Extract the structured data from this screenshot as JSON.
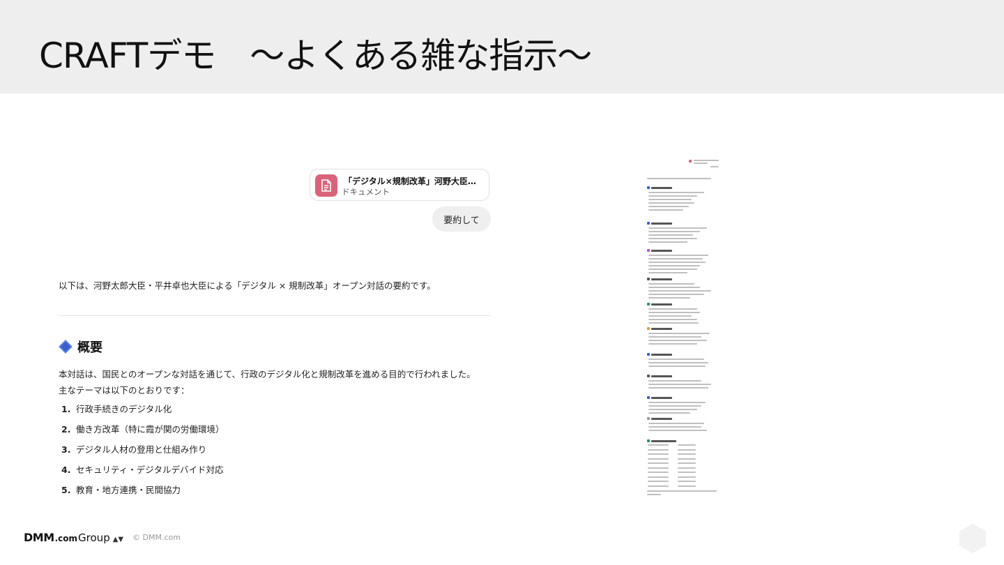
{
  "slide": {
    "title": "CRAFTデモ　～よくある雑な指示～"
  },
  "chat": {
    "attachment": {
      "title": "「デジタル×規制改革」河野大臣・平...",
      "type_label": "ドキュメント",
      "icon": "document-icon",
      "icon_color": "#d9637a"
    },
    "user_message": "要約して",
    "response": {
      "intro": "以下は、河野太郎大臣・平井卓也大臣による「デジタル × 規制改革」オープン対話の要約です。",
      "section_title": "概要",
      "section_icon": "blue-diamond-icon",
      "body_line1": "本対話は、国民とのオープンな対話を通じて、行政のデジタル化と規制改革を進める目的で行われました。",
      "body_line2": "主なテーマは以下のとおりです：",
      "themes": [
        {
          "num": "1.",
          "text": "行政手続きのデジタル化"
        },
        {
          "num": "2.",
          "text": "働き方改革（特に霞が関の労働環境）"
        },
        {
          "num": "3.",
          "text": "デジタル人材の登用と仕組み作り"
        },
        {
          "num": "4.",
          "text": "セキュリティ・デジタルデバイド対応"
        },
        {
          "num": "5.",
          "text": "教育・地方連携・民間協力"
        }
      ]
    }
  },
  "footer": {
    "logo_dmm": "DMM",
    "logo_com": ".com",
    "logo_group": "Group",
    "logo_mark": "▲▼",
    "copyright": "© DMM.com"
  },
  "colors": {
    "header_bg": "#eeeeee",
    "accent_pink": "#d9637a",
    "diamond_blue": "#3b5fc9"
  }
}
